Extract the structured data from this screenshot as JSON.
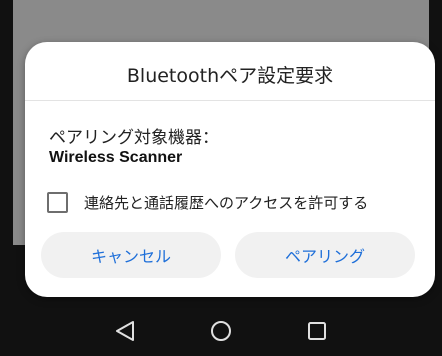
{
  "dialog": {
    "title": "Bluetoothペア設定要求",
    "target_label": "ペアリング対象機器：",
    "device_name": "Wireless Scanner",
    "checkbox_label": "連絡先と通話履歴へのアクセスを許可する",
    "checkbox_checked": false,
    "cancel_label": "キャンセル",
    "pair_label": "ペアリング",
    "accent_color": "#1e6fd9"
  },
  "navbar": {
    "items": [
      {
        "icon": "back-triangle-icon"
      },
      {
        "icon": "home-circle-icon"
      },
      {
        "icon": "recents-square-icon"
      }
    ]
  }
}
